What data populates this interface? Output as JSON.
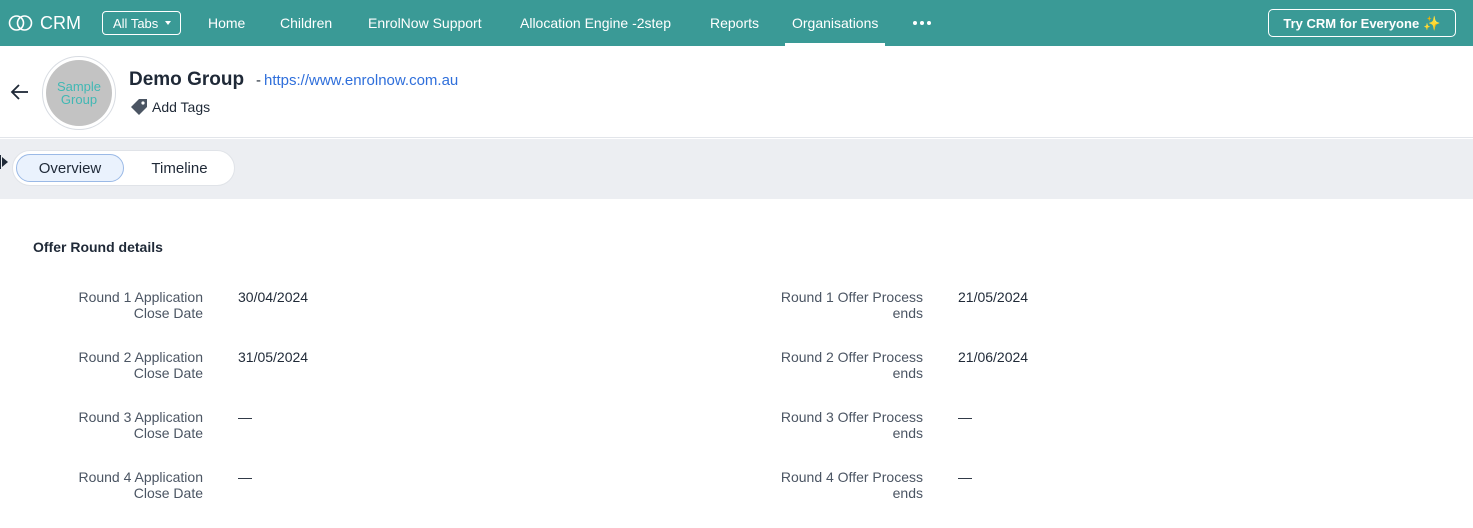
{
  "topnav": {
    "brand": "CRM",
    "all_tabs": "All Tabs",
    "tabs": [
      "Home",
      "Children",
      "EnrolNow Support",
      "Allocation Engine -2step",
      "Reports",
      "Organisations"
    ],
    "active_tab": "Organisations",
    "try_button": "Try CRM for Everyone",
    "colors": {
      "bar": "#3a9a96",
      "link": "#2f6fdb"
    }
  },
  "record": {
    "logo_text_line1": "Sample",
    "logo_text_line2": "Group",
    "title": "Demo Group",
    "separator": "-",
    "website": "https://www.enrolnow.com.au",
    "add_tags": "Add Tags"
  },
  "subtabs": {
    "items": [
      "Overview",
      "Timeline"
    ],
    "active": "Overview"
  },
  "section": {
    "title": "Offer Round details",
    "left_fields": [
      {
        "label_line1": "Round 1 Application",
        "label_line2": "Close Date",
        "value": "30/04/2024"
      },
      {
        "label_line1": "Round 2 Application",
        "label_line2": "Close Date",
        "value": "31/05/2024"
      },
      {
        "label_line1": "Round 3 Application",
        "label_line2": "Close Date",
        "value": "—"
      },
      {
        "label_line1": "Round 4 Application",
        "label_line2": "Close Date",
        "value": "—"
      }
    ],
    "right_fields": [
      {
        "label_line1": "Round 1 Offer Process",
        "label_line2": "ends",
        "value": "21/05/2024"
      },
      {
        "label_line1": "Round 2 Offer Process",
        "label_line2": "ends",
        "value": "21/06/2024"
      },
      {
        "label_line1": "Round 3 Offer Process",
        "label_line2": "ends",
        "value": "—"
      },
      {
        "label_line1": "Round 4 Offer Process",
        "label_line2": "ends",
        "value": "—"
      }
    ]
  }
}
